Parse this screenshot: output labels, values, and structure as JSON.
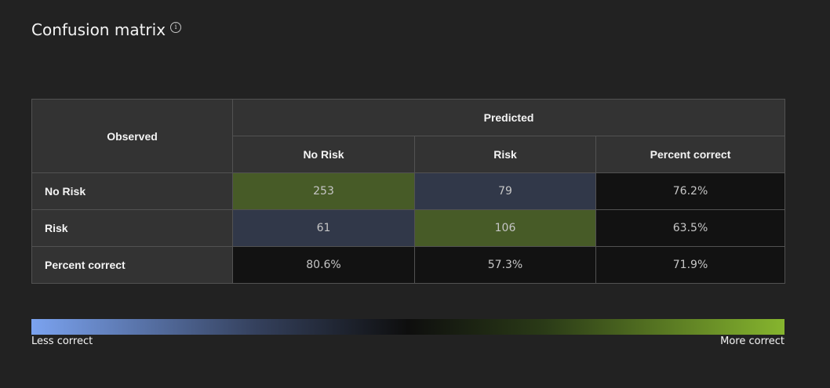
{
  "title": "Confusion matrix",
  "info_icon": "info-icon",
  "colors": {
    "background": "#222222",
    "header_bg": "#333333",
    "correct_cell": "#475b27",
    "incorrect_cell": "#313849",
    "percent_cell": "#121212",
    "gradient_low": "#7ba3f0",
    "gradient_mid": "#0e0e0e",
    "gradient_high": "#86b52e"
  },
  "matrix": {
    "observed_label": "Observed",
    "predicted_label": "Predicted",
    "columns": [
      "No Risk",
      "Risk",
      "Percent correct"
    ],
    "rows": [
      {
        "label": "No Risk",
        "values": [
          "253",
          "79",
          "76.2%"
        ]
      },
      {
        "label": "Risk",
        "values": [
          "61",
          "106",
          "63.5%"
        ]
      },
      {
        "label": "Percent correct",
        "values": [
          "80.6%",
          "57.3%",
          "71.9%"
        ]
      }
    ]
  },
  "legend": {
    "low_label": "Less correct",
    "high_label": "More correct"
  }
}
